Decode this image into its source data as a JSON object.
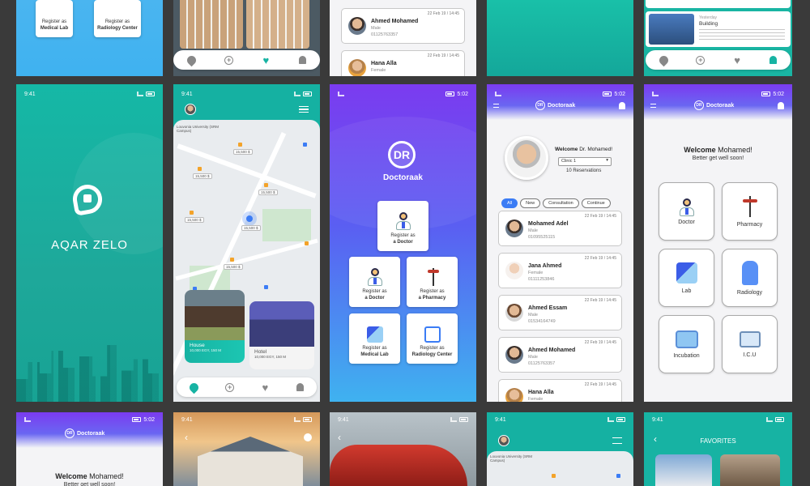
{
  "colors": {
    "teal": "#17b3a3",
    "purple": "#7b3bf0",
    "blue": "#3fb2f0",
    "accent_blue": "#3b7cf5",
    "background": "#3a3a3a"
  },
  "status_time": "9:41",
  "status_time_doc": "5:02",
  "aqar": {
    "brand": "AQAR ZELO"
  },
  "doc": {
    "brand": "Doctoraak",
    "logo_letters": "DR",
    "register_prefix": "Register as",
    "roles": {
      "doctor": "a Doctor",
      "pharmacy": "a Pharmacy",
      "lab": "Medical Lab",
      "radiology": "Radiology Center"
    }
  },
  "map_price": "15,500 $",
  "map_label_left": "Louvonia University\n(SRM Campus)",
  "listings": [
    {
      "title": "House",
      "price": "10,000 EGY",
      "area": "150 M"
    },
    {
      "title": "Hotel",
      "price": "10,000 EGY",
      "area": "150 M"
    }
  ],
  "reservations": {
    "welcome": "Welcome",
    "doctor_name": "Dr. Mohamed!",
    "clinic": "Clinic 1",
    "count": "10 Reservations",
    "filters": [
      "All",
      "New",
      "Consultation",
      "Continue"
    ],
    "patients": [
      {
        "name": "Mohamed Adel",
        "gender": "Male",
        "phone": "01095525115",
        "date": "22 Feb 19 / 14:45"
      },
      {
        "name": "Jana Ahmed",
        "gender": "Female",
        "phone": "01111253846",
        "date": "22 Feb 19 / 14:45"
      },
      {
        "name": "Ahmed Essam",
        "gender": "Male",
        "phone": "01534164749",
        "date": "22 Feb 19 / 14:45"
      },
      {
        "name": "Ahmed Mohamed",
        "gender": "Male",
        "phone": "01125763357",
        "date": "22 Feb 19 / 14:45"
      },
      {
        "name": "Hana Alla",
        "gender": "Female",
        "date": "22 Feb 19 / 14:45"
      }
    ]
  },
  "top_patients": [
    {
      "name": "Ahmed Mohamed",
      "gender": "Male",
      "phone": "01125763357",
      "date": "22 Feb 19 / 14:45"
    },
    {
      "name": "Hana Alla",
      "gender": "Female",
      "date": "22 Feb 19 / 14:45"
    }
  ],
  "home": {
    "welcome": "Welcome",
    "name": "Mohamed!",
    "subtitle": "Better get well soon!",
    "services": [
      "Doctor",
      "Pharmacy",
      "Lab",
      "Radiology",
      "Incubation",
      "I.C.U"
    ]
  },
  "news": {
    "when": "Yesterday",
    "title": "Building"
  },
  "favorites_title": "FAVORITES"
}
